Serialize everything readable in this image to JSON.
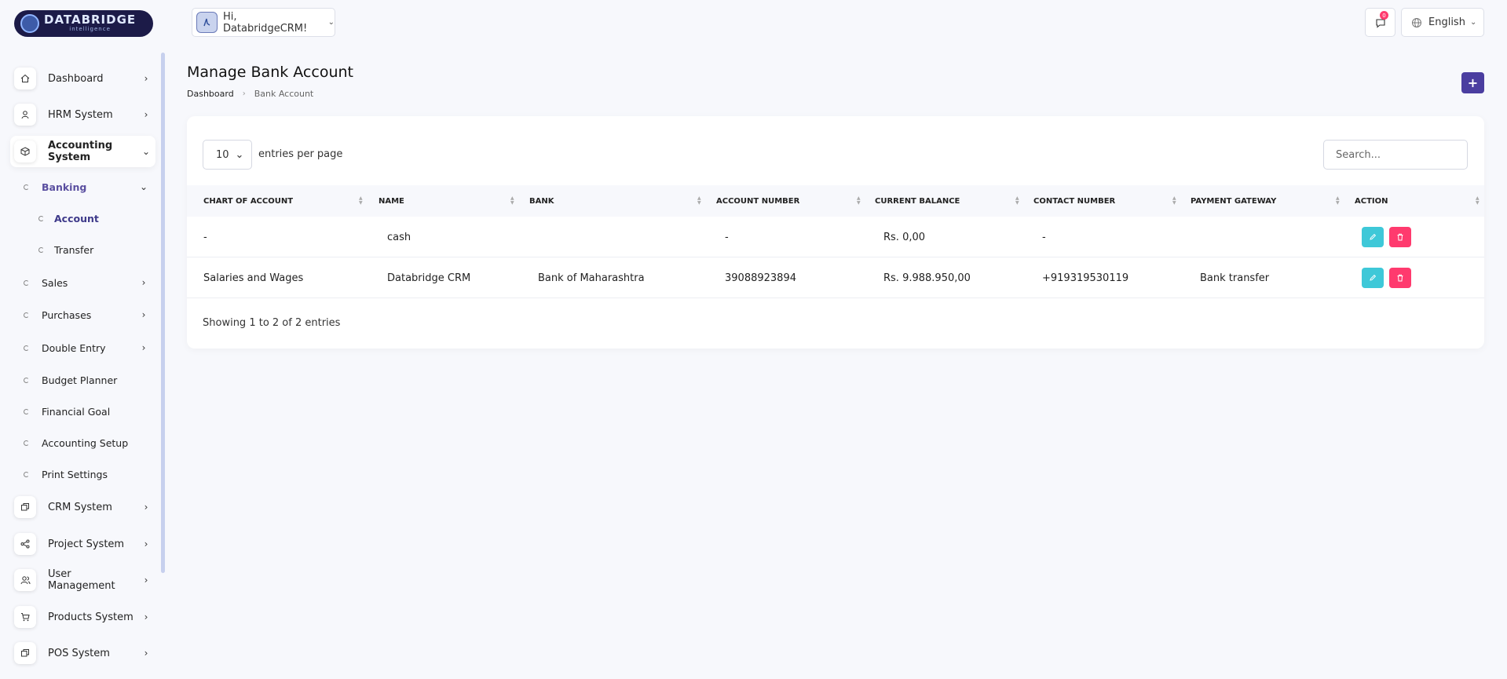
{
  "brand": {
    "name": "DATABRIDGE",
    "tagline": "intelligence"
  },
  "header": {
    "greeting": "Hi, DatabridgeCRM!",
    "notification_count": "0",
    "language": "English"
  },
  "sidebar": {
    "items": [
      {
        "label": "Dashboard",
        "icon": "home-icon"
      },
      {
        "label": "HRM System",
        "icon": "user-icon"
      },
      {
        "label": "Accounting System",
        "icon": "box-icon"
      },
      {
        "label": "CRM System",
        "icon": "layers-icon"
      },
      {
        "label": "Project System",
        "icon": "share-icon"
      },
      {
        "label": "User Management",
        "icon": "users-icon"
      },
      {
        "label": "Products System",
        "icon": "cart-icon"
      },
      {
        "label": "POS System",
        "icon": "layers-icon"
      }
    ],
    "accounting_sub": [
      {
        "label": "Banking"
      },
      {
        "label": "Sales"
      },
      {
        "label": "Purchases"
      },
      {
        "label": "Double Entry"
      },
      {
        "label": "Budget Planner"
      },
      {
        "label": "Financial Goal"
      },
      {
        "label": "Accounting Setup"
      },
      {
        "label": "Print Settings"
      }
    ],
    "banking_sub": [
      {
        "label": "Account"
      },
      {
        "label": "Transfer"
      }
    ]
  },
  "page": {
    "title": "Manage Bank Account",
    "breadcrumb": [
      "Dashboard",
      "Bank Account"
    ],
    "add_label": "+"
  },
  "table": {
    "per_page": "10",
    "per_page_label": "entries per page",
    "search_placeholder": "Search...",
    "columns": [
      "CHART OF ACCOUNT",
      "NAME",
      "BANK",
      "ACCOUNT NUMBER",
      "CURRENT BALANCE",
      "CONTACT NUMBER",
      "PAYMENT GATEWAY",
      "ACTION"
    ],
    "rows": [
      {
        "chart": "-",
        "name": "cash",
        "bank": "",
        "account_number": "-",
        "balance": "Rs. 0,00",
        "contact": "-",
        "gateway": ""
      },
      {
        "chart": "Salaries and Wages",
        "name": "Databridge CRM",
        "bank": "Bank of Maharashtra",
        "account_number": "39088923894",
        "balance": "Rs. 9.988.950,00",
        "contact": "+919319530119",
        "gateway": "Bank transfer"
      }
    ],
    "footer": "Showing 1 to 2 of 2 entries"
  },
  "colors": {
    "accent": "#4b3ea0",
    "edit": "#3ec8d8",
    "delete": "#ff3a6e"
  }
}
